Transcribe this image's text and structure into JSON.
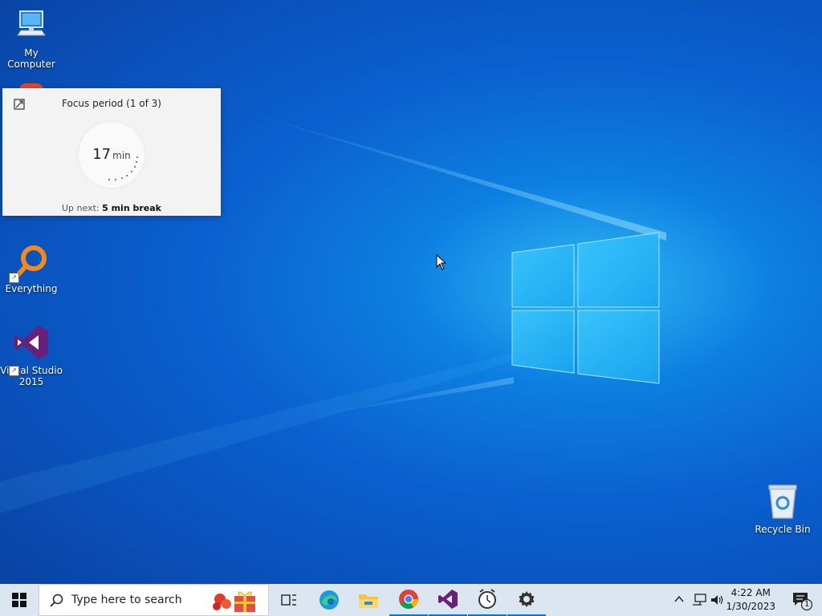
{
  "desktop": {
    "icons": [
      {
        "label": "My Computer",
        "icon": "computer-icon"
      },
      {
        "label": "Everything",
        "icon": "everything-search-icon"
      },
      {
        "label": "Visual Studio 2015",
        "icon": "visual-studio-icon"
      },
      {
        "label": "Recycle Bin",
        "icon": "recycle-bin-icon"
      }
    ]
  },
  "focus_widget": {
    "title": "Focus period (1 of 3)",
    "minutes": "17",
    "unit": "min",
    "up_next_label": "Up next:",
    "up_next_value": "5 min break"
  },
  "taskbar": {
    "search_placeholder": "Type here to search",
    "apps": [
      "task-view-icon",
      "edge-icon",
      "file-explorer-icon",
      "chrome-icon",
      "visual-studio-icon",
      "clock-app-icon",
      "settings-icon"
    ],
    "time": "4:22 AM",
    "date": "1/30/2023",
    "notification_count": "1"
  },
  "colors": {
    "accent": "#0078d4",
    "taskbar_bg": "#dce6f1",
    "vs_purple": "#68217a"
  }
}
